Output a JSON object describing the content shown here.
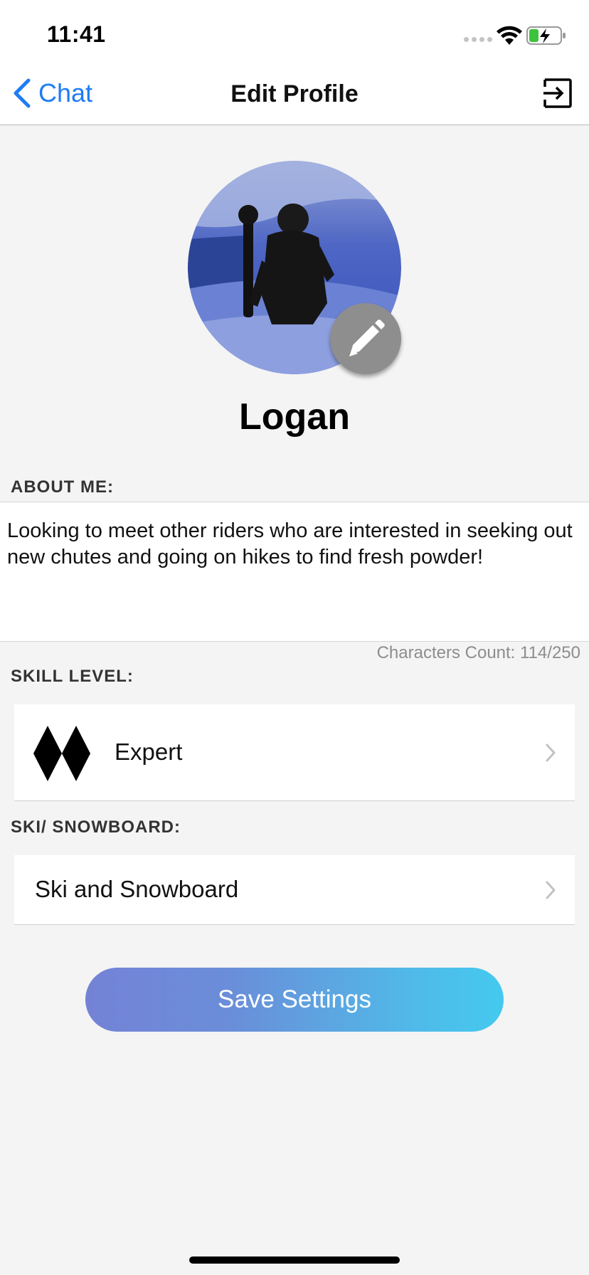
{
  "status_bar": {
    "time": "11:41"
  },
  "nav": {
    "back_label": "Chat",
    "title": "Edit Profile",
    "logout_icon": "logout-icon"
  },
  "profile": {
    "name": "Logan",
    "edit_icon": "pencil-icon"
  },
  "about": {
    "label": "ABOUT ME:",
    "text": "Looking to meet other riders who are interested in seeking out new chutes and going on hikes to find fresh powder!",
    "char_count": "Characters Count: 114/250"
  },
  "skill": {
    "label": "SKILL LEVEL:",
    "value": "Expert",
    "icon": "double-black-diamond-icon"
  },
  "sport": {
    "label": "SKI/ SNOWBOARD:",
    "value": "Ski and Snowboard"
  },
  "save_button": {
    "label": "Save Settings"
  },
  "colors": {
    "accent": "#1f7cf4",
    "background": "#f4f4f4",
    "button_gradient_start": "#7482d6",
    "button_gradient_end": "#44c9ef"
  }
}
